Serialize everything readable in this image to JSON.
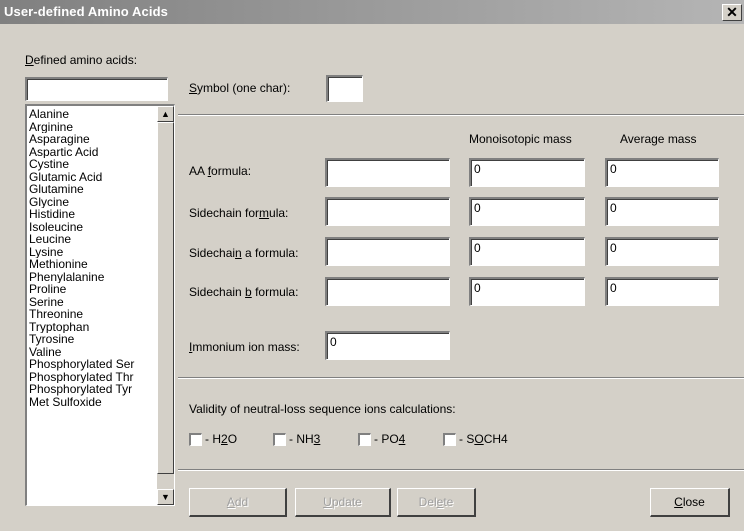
{
  "window": {
    "title": "User-defined Amino Acids",
    "close_glyph": "✕"
  },
  "list": {
    "label_key": "D",
    "label_rest": "efined amino acids:",
    "search_value": "",
    "items": [
      "Alanine",
      "Arginine",
      "Asparagine",
      "Aspartic Acid",
      "Cystine",
      "Glutamic Acid",
      "Glutamine",
      "Glycine",
      "Histidine",
      "Isoleucine",
      "Leucine",
      "Lysine",
      "Methionine",
      "Phenylalanine",
      "Proline",
      "Serine",
      "Threonine",
      "Tryptophan",
      "Tyrosine",
      "Valine",
      "Phosphorylated Ser",
      "Phosphorylated Thr",
      "Phosphorylated Tyr",
      "Met Sulfoxide"
    ]
  },
  "symbol": {
    "label_key": "S",
    "label_rest": "ymbol (one char):",
    "value": ""
  },
  "columns": {
    "monoisotopic": "Monoisotopic mass",
    "average": "Average mass"
  },
  "rows": [
    {
      "pre": "AA ",
      "key": "f",
      "post": "ormula:",
      "formula": "",
      "mono": "0",
      "avg": "0"
    },
    {
      "pre": "Sidechain for",
      "key": "m",
      "post": "ula:",
      "formula": "",
      "mono": "0",
      "avg": "0"
    },
    {
      "pre": "Sidechai",
      "key": "n",
      "post": " a formula:",
      "formula": "",
      "mono": "0",
      "avg": "0"
    },
    {
      "pre": "Sidechain ",
      "key": "b",
      "post": " formula:",
      "formula": "",
      "mono": "0",
      "avg": "0"
    }
  ],
  "immonium": {
    "label_key": "I",
    "label_rest": "mmonium ion mass:",
    "value": "0"
  },
  "validity": {
    "label": "Validity of neutral-loss sequence ions calculations:",
    "checks": [
      {
        "pre": "- H",
        "key": "2",
        "post": "O",
        "checked": false
      },
      {
        "pre": "- NH",
        "key": "3",
        "post": "",
        "checked": false
      },
      {
        "pre": "- PO",
        "key": "4",
        "post": "",
        "checked": false
      },
      {
        "pre": "- S",
        "key": "O",
        "post": "CH4",
        "checked": false
      }
    ]
  },
  "buttons": {
    "add": {
      "key": "A",
      "rest": "dd"
    },
    "update": {
      "key": "U",
      "rest": "pdate"
    },
    "delete": {
      "pre": "Del",
      "key": "e",
      "rest": "te"
    },
    "close": {
      "key": "C",
      "rest": "lose"
    }
  }
}
